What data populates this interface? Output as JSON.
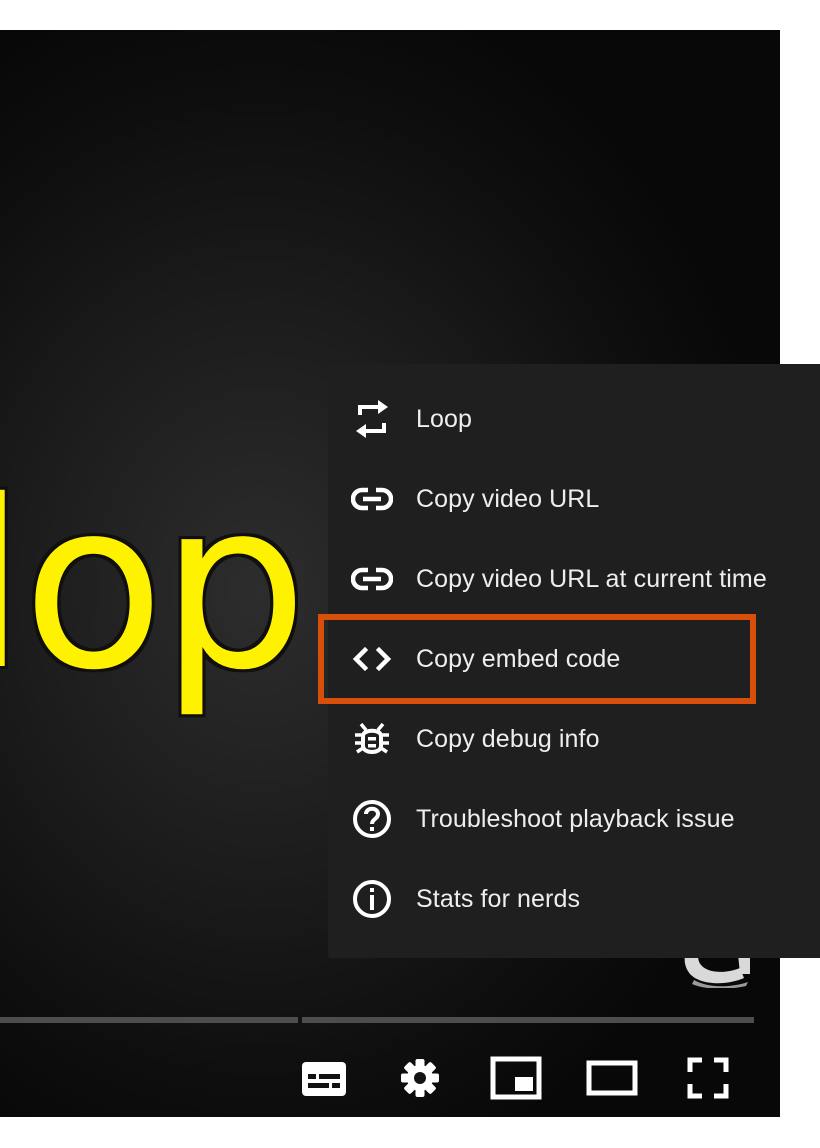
{
  "video": {
    "frame_text": "lop"
  },
  "context_menu": {
    "items": [
      {
        "label": "Loop",
        "icon": "loop-icon"
      },
      {
        "label": "Copy video URL",
        "icon": "link-icon"
      },
      {
        "label": "Copy video URL at current time",
        "icon": "link-icon"
      },
      {
        "label": "Copy embed code",
        "icon": "embed-code-icon"
      },
      {
        "label": "Copy debug info",
        "icon": "bug-icon"
      },
      {
        "label": "Troubleshoot playback issue",
        "icon": "question-circle-icon"
      },
      {
        "label": "Stats for nerds",
        "icon": "info-circle-icon"
      }
    ],
    "highlighted_item": "Copy embed code",
    "highlight_color": "#d84f0a"
  },
  "controls": {
    "buttons": [
      "subtitles-icon",
      "settings-gear-icon",
      "miniplayer-icon",
      "theater-mode-icon",
      "fullscreen-icon"
    ]
  },
  "colors": {
    "menu_background": "#1f1f1f",
    "menu_text": "#eeeeee",
    "frame_text": "#fff200"
  }
}
